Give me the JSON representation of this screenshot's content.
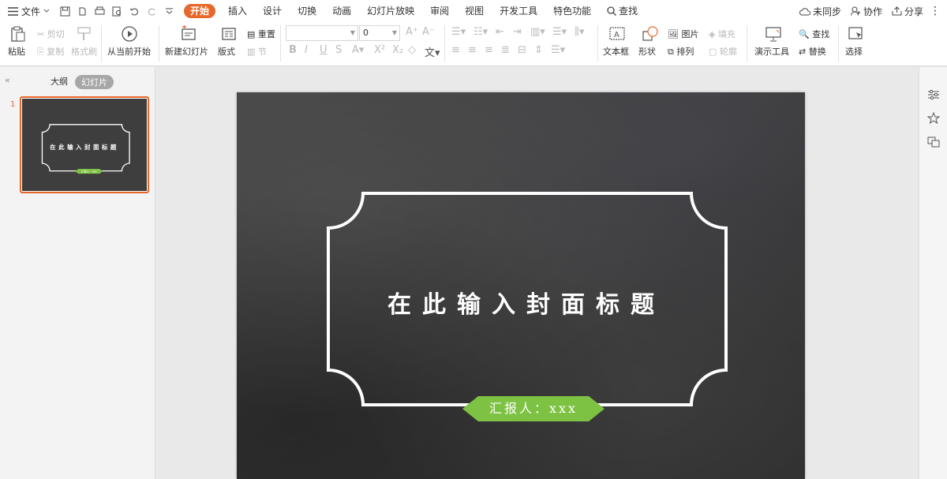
{
  "menubar": {
    "file_label": "文件",
    "tabs": [
      {
        "label": "开始",
        "active": true
      },
      {
        "label": "插入"
      },
      {
        "label": "设计"
      },
      {
        "label": "切换"
      },
      {
        "label": "动画"
      },
      {
        "label": "幻灯片放映"
      },
      {
        "label": "审阅"
      },
      {
        "label": "视图"
      },
      {
        "label": "开发工具"
      },
      {
        "label": "特色功能"
      }
    ],
    "search_label": "查找",
    "sync_label": "未同步",
    "collab_label": "协作",
    "share_label": "分享"
  },
  "ribbon": {
    "paste": "粘贴",
    "cut": "剪切",
    "copy": "复制",
    "format_painter": "格式刷",
    "from_current": "从当前开始",
    "new_slide": "新建幻灯片",
    "layout": "版式",
    "reset": "重置",
    "section": "节",
    "font_size_value": "0",
    "font_name_value": "",
    "textbox": "文本框",
    "shape": "形状",
    "picture": "图片",
    "arrange": "排列",
    "fill": "填充",
    "outline": "轮廓",
    "present_tools": "演示工具",
    "find": "查找",
    "replace": "替换",
    "select": "选择"
  },
  "leftpanel": {
    "outline_tab": "大纲",
    "slides_tab": "幻灯片",
    "slide_number": "1"
  },
  "slide": {
    "title": "在此输入封面标题",
    "reporter": "汇报人：xxx"
  },
  "colors": {
    "accent": "#e7682b",
    "badge_green": "#7dc242"
  }
}
